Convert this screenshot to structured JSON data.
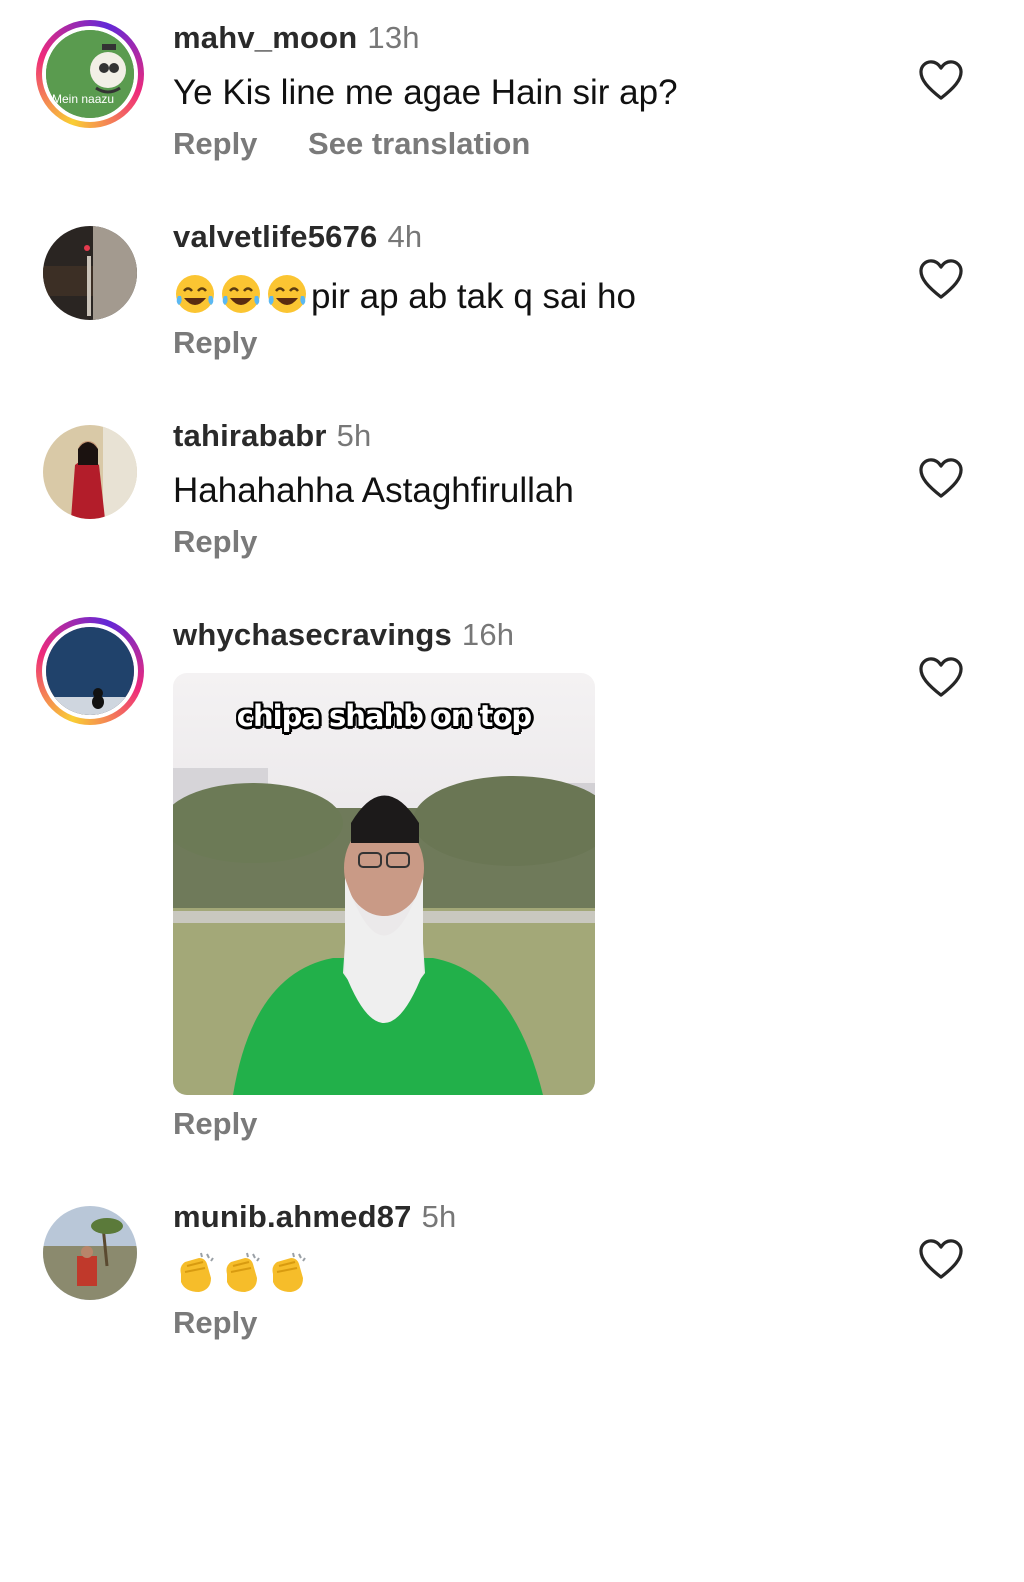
{
  "comments": [
    {
      "username": "mahv_moon",
      "time": "13h",
      "text": "Ye Kis line me agae Hain sir ap?",
      "reply_label": "Reply",
      "translate_label": "See translation",
      "avatar_caption": "Mein naazu"
    },
    {
      "username": "valvetlife5676",
      "time": "4h",
      "emojis": [
        "face-with-tears-of-joy",
        "face-with-tears-of-joy",
        "face-with-tears-of-joy"
      ],
      "text": "pir ap ab tak q sai ho",
      "reply_label": "Reply"
    },
    {
      "username": "tahirababr",
      "time": "5h",
      "text": "Hahahahha Astaghfirullah",
      "reply_label": "Reply"
    },
    {
      "username": "whychasecravings",
      "time": "16h",
      "gif_caption": "chipa shahb on top",
      "reply_label": "Reply"
    },
    {
      "username": "munib.ahmed87",
      "time": "5h",
      "emojis": [
        "clapping-hands",
        "clapping-hands",
        "clapping-hands"
      ],
      "reply_label": "Reply"
    }
  ],
  "colors": {
    "username": "#2a2a2a",
    "meta": "#7a7a7a",
    "ring_gradient": [
      "#f9ce34",
      "#ee2a7b",
      "#6228d7"
    ],
    "gif_shirt": "#22b04a"
  }
}
